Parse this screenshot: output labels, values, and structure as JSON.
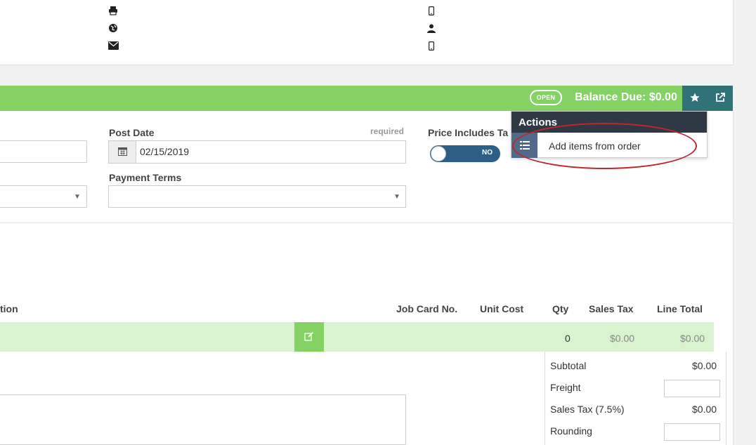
{
  "status": {
    "badge": "OPEN",
    "balance": "Balance Due: $0.00"
  },
  "form": {
    "post_date_label": "Post Date",
    "required_text": "required",
    "post_date_value": "02/15/2019",
    "price_includes_label": "Price Includes Ta",
    "toggle_value": "NO",
    "payment_terms_label": "Payment Terms",
    "payment_terms_value": ""
  },
  "actions": {
    "title": "Actions",
    "item": "Add items from order"
  },
  "table": {
    "headers": [
      "tion",
      "Job Card No.",
      "Unit Cost",
      "Qty",
      "Sales Tax",
      "Line Total"
    ],
    "row": {
      "qty": "0",
      "sales_tax": "$0.00",
      "line_total": "$0.00"
    }
  },
  "totals": {
    "subtotal_label": "Subtotal",
    "subtotal_value": "$0.00",
    "freight_label": "Freight",
    "tax_label": "Sales Tax (7.5%)",
    "tax_value": "$0.00",
    "rounding_label": "Rounding"
  },
  "icons": [
    "printer-icon",
    "globe-icon",
    "envelope-icon",
    "mobile-icon",
    "user-icon",
    "calendar-icon",
    "star-icon",
    "external-link-icon",
    "list-icon",
    "edit-icon"
  ],
  "colors": {
    "green": "#84d164",
    "teal": "#2f7379",
    "toggle": "#2d5f86",
    "menu_head": "#2f3845",
    "highlight": "#c0272d"
  }
}
